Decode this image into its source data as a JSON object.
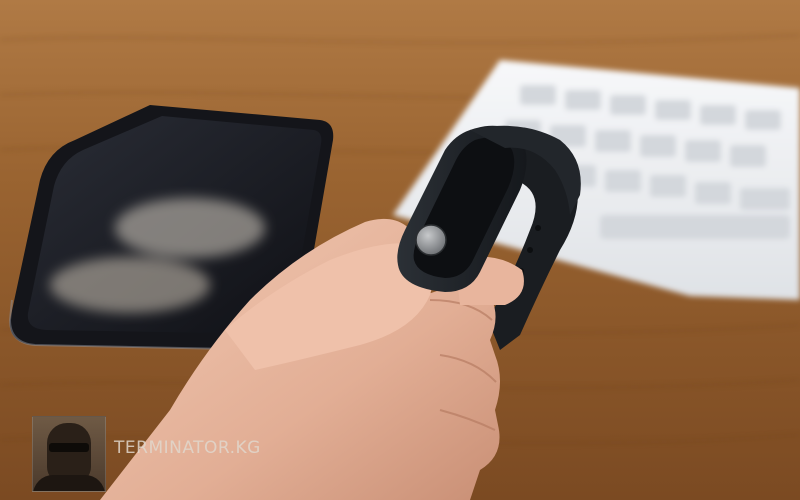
{
  "watermark": {
    "text": "TERMINATOR.KG",
    "logo_icon": "terminator-portrait-logo"
  },
  "colors": {
    "table_wood": "#9a6432",
    "phone_body": "#1b1c22",
    "keyboard": "#f1f3f5",
    "band": "#1f2328",
    "skin": "#e7b8a0"
  }
}
